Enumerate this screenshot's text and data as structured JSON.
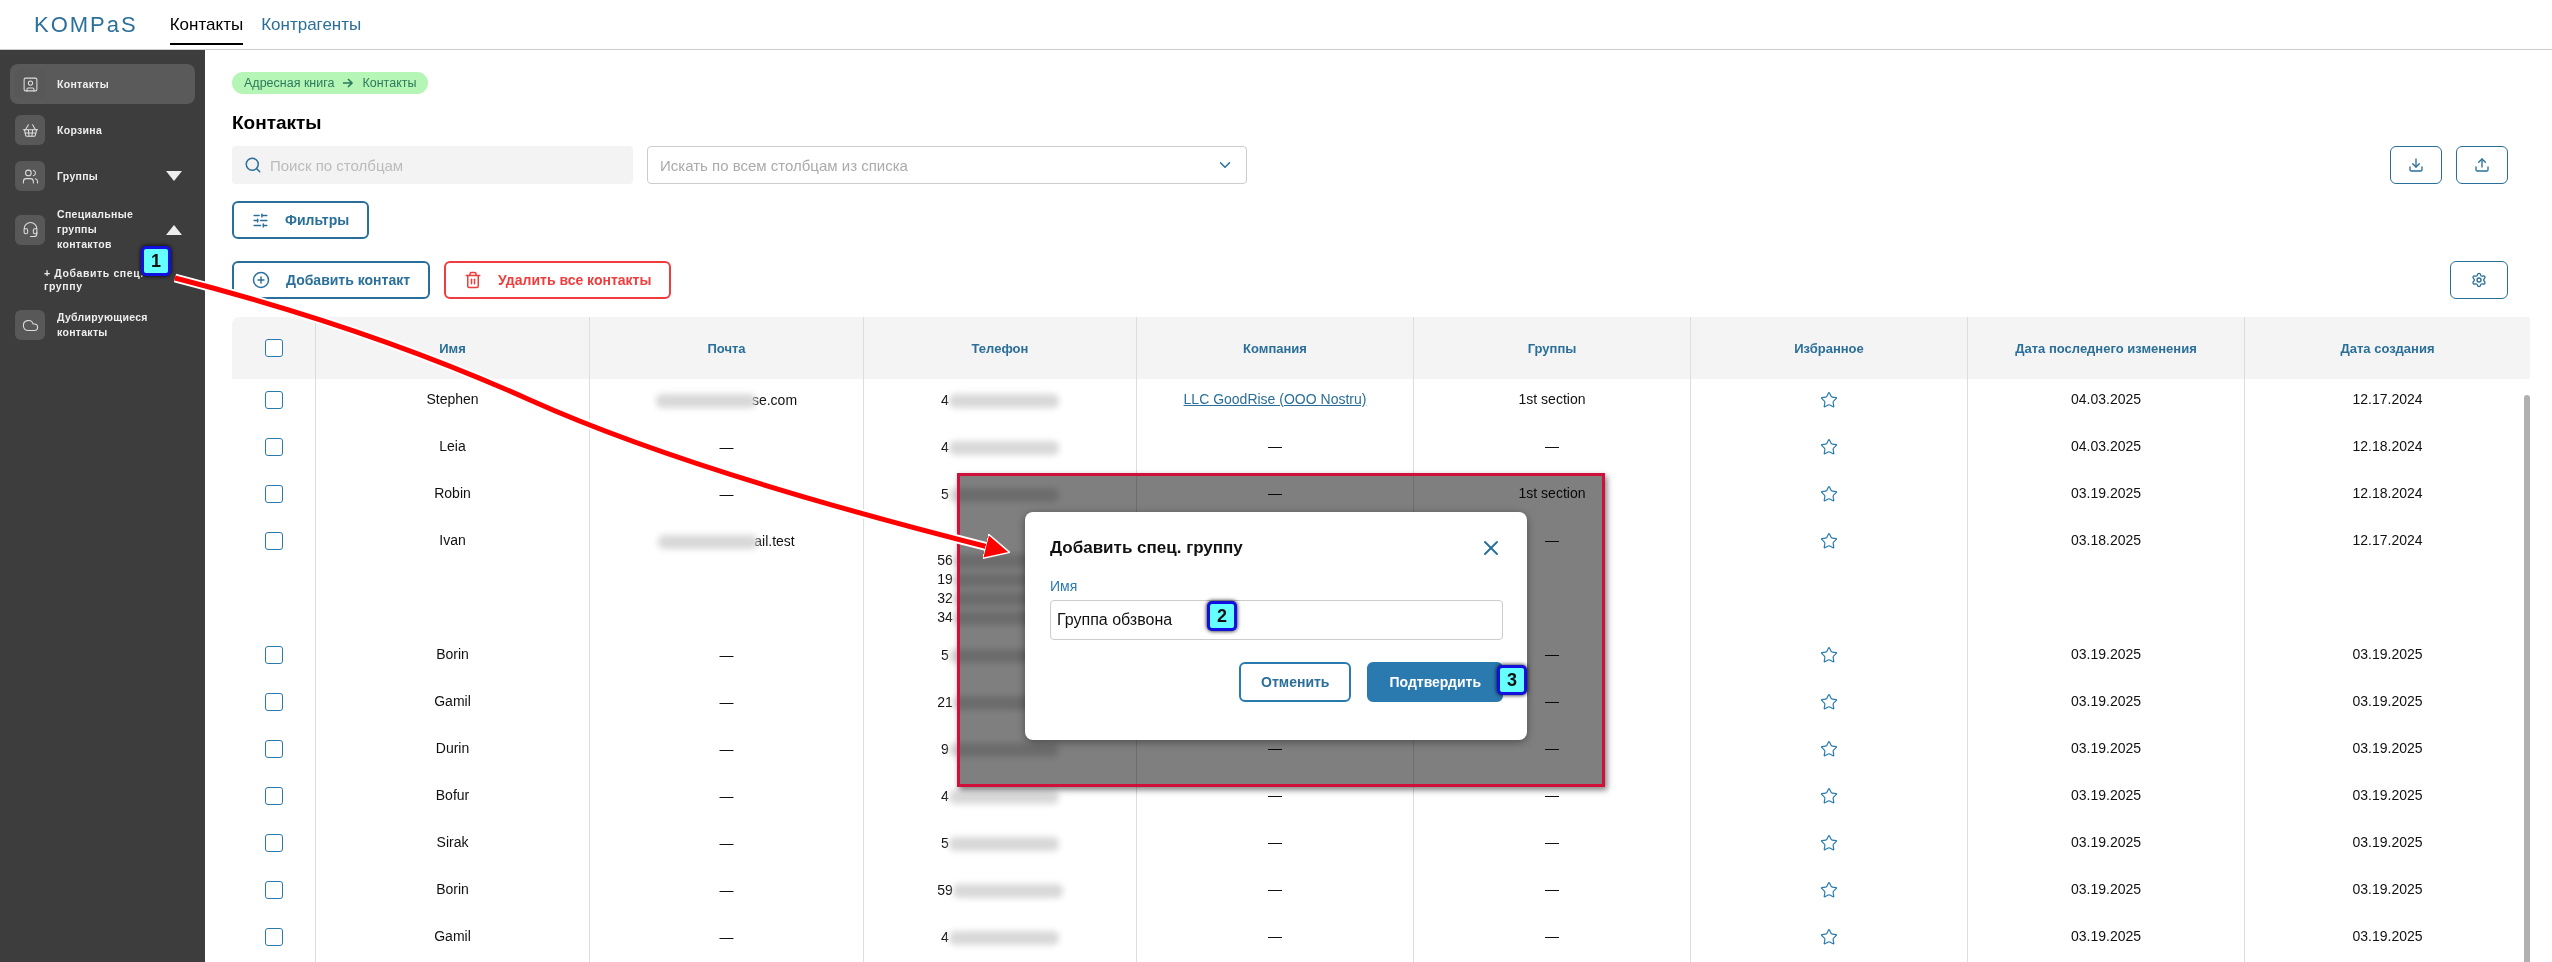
{
  "header": {
    "logo": "KOMPaS",
    "tabs": [
      {
        "label": "Контакты",
        "selected": true
      },
      {
        "label": "Контрагенты",
        "selected": false
      }
    ]
  },
  "sidebar": {
    "items": [
      {
        "kind": "contacts",
        "label": "Контакты",
        "selected": true
      },
      {
        "kind": "trash",
        "label": "Корзина",
        "selected": false
      },
      {
        "kind": "groups",
        "label": "Группы",
        "selected": false,
        "expanded": false
      },
      {
        "kind": "special",
        "label": "Специальные группы контактов",
        "selected": false,
        "expanded": true,
        "children": [
          {
            "label": "+ Добавить спец. группу"
          }
        ]
      },
      {
        "kind": "duplicates",
        "label": "Дублирующиеся контакты",
        "selected": false
      }
    ]
  },
  "breadcrumb": [
    "Адресная книга",
    "Контакты"
  ],
  "title": "Контакты",
  "search": {
    "placeholder": "Поиск по столбцам"
  },
  "column_select": {
    "placeholder": "Искать по всем столбцам из списка"
  },
  "filters_button": "Фильтры",
  "add_button": "Добавить контакт",
  "delete_button": "Удалить все контакты",
  "table": {
    "select_all": {
      "checked": false
    },
    "columns": [
      "Имя",
      "Почта",
      "Телефон",
      "Компания",
      "Группы",
      "Избранное",
      "Дата последнего изменения",
      "Дата создания"
    ],
    "rows": [
      {
        "checked": false,
        "name": "Stephen",
        "email": "se.com",
        "email_blurred": true,
        "phone": [
          "4"
        ],
        "company": "LLC GoodRise (OOO Nostru)",
        "company_link": true,
        "groups": "1st section",
        "favorite": false,
        "modified": "04.03.2025",
        "created": "12.17.2024"
      },
      {
        "checked": false,
        "name": "Leia",
        "email": "—",
        "phone": [
          "4"
        ],
        "company": "—",
        "groups": "—",
        "favorite": false,
        "modified": "04.03.2025",
        "created": "12.18.2024"
      },
      {
        "checked": false,
        "name": "Robin",
        "email": "—",
        "phone": [
          "5"
        ],
        "company": "—",
        "groups": "1st section",
        "favorite": false,
        "modified": "03.19.2025",
        "created": "12.18.2024"
      },
      {
        "checked": false,
        "name": "Ivan",
        "email": "ail.test",
        "email_blurred": true,
        "phone": [
          "56",
          "19",
          "32",
          "34"
        ],
        "groups": "—",
        "favorite": false,
        "modified": "03.18.2025",
        "created": "12.17.2024"
      },
      {
        "checked": false,
        "name": "Borin",
        "email": "—",
        "phone": [
          "5"
        ],
        "groups": "—",
        "favorite": false,
        "modified": "03.19.2025",
        "created": "03.19.2025"
      },
      {
        "checked": false,
        "name": "Gamil",
        "email": "—",
        "phone": [
          "21"
        ],
        "groups": "—",
        "favorite": false,
        "modified": "03.19.2025",
        "created": "03.19.2025"
      },
      {
        "checked": false,
        "name": "Durin",
        "email": "—",
        "phone": [
          "9"
        ],
        "company": "—",
        "groups": "—",
        "favorite": false,
        "modified": "03.19.2025",
        "created": "03.19.2025"
      },
      {
        "checked": false,
        "name": "Bofur",
        "email": "—",
        "phone": [
          "4"
        ],
        "company": "—",
        "groups": "—",
        "favorite": false,
        "modified": "03.19.2025",
        "created": "03.19.2025"
      },
      {
        "checked": false,
        "name": "Sirak",
        "email": "—",
        "phone": [
          "5"
        ],
        "company": "—",
        "groups": "—",
        "favorite": false,
        "modified": "03.19.2025",
        "created": "03.19.2025"
      },
      {
        "checked": false,
        "name": "Borin",
        "email": "—",
        "phone": [
          "59"
        ],
        "company": "—",
        "groups": "—",
        "favorite": false,
        "modified": "03.19.2025",
        "created": "03.19.2025"
      },
      {
        "checked": false,
        "name": "Gamil",
        "email": "—",
        "phone": [
          "4"
        ],
        "company": "—",
        "groups": "—",
        "favorite": false,
        "modified": "03.19.2025",
        "created": "03.19.2025"
      }
    ]
  },
  "dialog": {
    "title": "Добавить спец. группу",
    "field_label": "Имя",
    "field_value": "Группа обзвона",
    "cancel": "Отменить",
    "confirm": "Подтвердить"
  },
  "annotations": [
    "1",
    "2",
    "3"
  ]
}
